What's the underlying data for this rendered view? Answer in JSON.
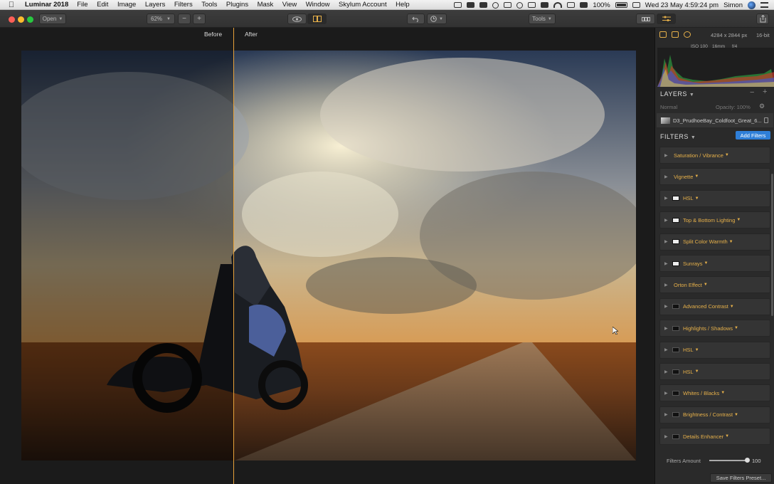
{
  "menubar": {
    "app_name": "Luminar 2018",
    "items": [
      "File",
      "Edit",
      "Image",
      "Layers",
      "Filters",
      "Tools",
      "Plugins",
      "Mask",
      "View",
      "Window",
      "Skylum Account",
      "Help"
    ],
    "battery": "100%",
    "datetime": "Wed 23 May  4:59:24 pm",
    "user": "Simon"
  },
  "toolbar": {
    "open_label": "Open",
    "zoom_value": "62%",
    "zoom_out": "−",
    "zoom_in": "+",
    "tools_label": "Tools"
  },
  "stage": {
    "before_label": "Before",
    "after_label": "After"
  },
  "info": {
    "dimensions": "4284 x 2844 px",
    "bit_depth": "16-bit",
    "iso": "ISO 100",
    "focal": "16mm",
    "aperture": "f/4"
  },
  "layers": {
    "title": "LAYERS",
    "blend_mode": "Normal",
    "opacity": "Opacity: 100%",
    "layer_name": "D3_PrudhoeBay_Coldfoot_Great_6..."
  },
  "filters": {
    "title": "FILTERS",
    "add_label": "Add Filters",
    "items": [
      {
        "name": "Saturation / Vibrance",
        "thumb": false
      },
      {
        "name": "Vignette",
        "thumb": false
      },
      {
        "name": "HSL",
        "thumb": true
      },
      {
        "name": "Top & Bottom Lighting",
        "thumb": true
      },
      {
        "name": "Split Color Warmth",
        "thumb": true
      },
      {
        "name": "Sunrays",
        "thumb": true
      },
      {
        "name": "Orton Effect",
        "thumb": false
      },
      {
        "name": "Advanced Contrast",
        "thumb": true
      },
      {
        "name": "Highlights / Shadows",
        "thumb": true
      },
      {
        "name": "HSL",
        "thumb": true
      },
      {
        "name": "HSL",
        "thumb": true
      },
      {
        "name": "Whites / Blacks",
        "thumb": true
      },
      {
        "name": "Brightness / Contrast",
        "thumb": true
      },
      {
        "name": "Details Enhancer",
        "thumb": true
      }
    ],
    "amount_label": "Filters Amount",
    "amount_value": "100",
    "amount_level": 1.0,
    "save_preset": "Save Filters Preset..."
  },
  "colors": {
    "accent": "#e6b04a",
    "split_line": "#e8a23a",
    "add_button": "#2f7fd8"
  }
}
